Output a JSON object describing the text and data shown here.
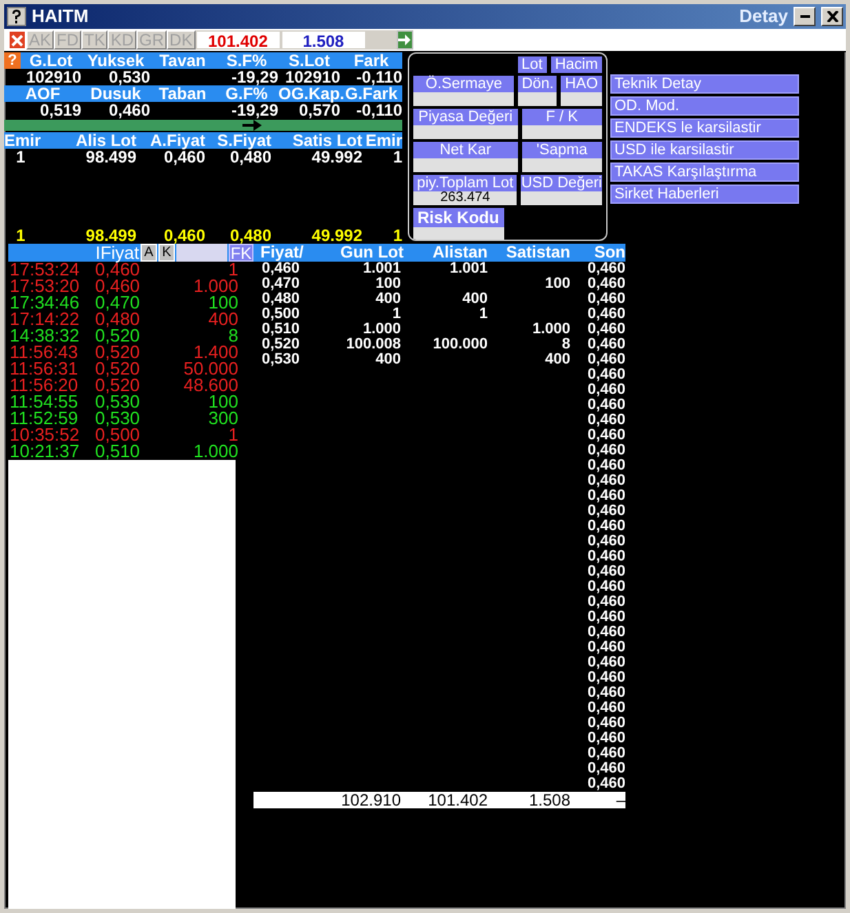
{
  "window": {
    "title": "HAITM",
    "subtitle": "Detay"
  },
  "toolbar": {
    "buttons": [
      {
        "label": "AK",
        "disabled": true
      },
      {
        "label": "FD",
        "disabled": true
      },
      {
        "label": "TK",
        "disabled": true
      },
      {
        "label": "KD",
        "disabled": true
      },
      {
        "label": "GR",
        "disabled": true
      },
      {
        "label": "DK",
        "disabled": true
      }
    ],
    "price": "101.402",
    "quantity": "1.508"
  },
  "summary": {
    "help_label": "?",
    "blocks": [
      {
        "cells": [
          {
            "header": "G.Lot",
            "value": "102910"
          },
          {
            "header": "Yuksek",
            "value": "0,530"
          },
          {
            "header": "Tavan"
          },
          {
            "header": "S.F%",
            "value": "-19,29"
          },
          {
            "header": "S.Lot",
            "value": "102910"
          },
          {
            "header": "Fark",
            "value": "-0,110"
          }
        ]
      },
      {
        "cells": [
          {
            "header": "AOF",
            "value": "0,519"
          },
          {
            "header": "Dusuk",
            "value": "0,460"
          },
          {
            "header": "Taban"
          },
          {
            "header": "G.F%",
            "value": "-19,29"
          },
          {
            "header": "OG.Kap.",
            "value": "0,570"
          },
          {
            "header": "G.Fark",
            "value": "-0,110"
          }
        ]
      }
    ]
  },
  "order_book": {
    "columns": [
      "Emir",
      "Alis Lot",
      "A.Fiyat",
      "S.Fiyat",
      "Satis Lot",
      "Emir"
    ],
    "rows": [
      [
        "1",
        "98.499",
        "0,460",
        "0,480",
        "49.992",
        "1"
      ]
    ],
    "totals": [
      "1",
      "98.499",
      "0,460",
      "0,480",
      "49.992",
      "1"
    ]
  },
  "info_panel": {
    "buttons": [
      "Lot",
      "Hacim"
    ],
    "rows": [
      [
        {
          "label": "Ö.Sermaye",
          "kind": "field"
        },
        {
          "label": "Dön.",
          "kind": "field"
        },
        {
          "label": "HAO",
          "kind": "field"
        }
      ],
      [
        {
          "label": "Piyasa Değeri",
          "kind": "field"
        },
        {
          "label": "F / K",
          "kind": "field"
        }
      ],
      [
        {
          "label": "Net Kar",
          "kind": "field"
        },
        {
          "label": "'Sapma",
          "kind": "field"
        }
      ],
      [
        {
          "label": "piy.Toplam Lot",
          "kind": "field",
          "value": "263.474"
        },
        {
          "label": "USD Değeri",
          "kind": "field"
        }
      ],
      [
        {
          "label": "Risk Kodu",
          "kind": "code"
        }
      ]
    ]
  },
  "menu": {
    "items": [
      "Teknik Detay",
      "OD. Mod.",
      "ENDEKS le karsilastir",
      "USD ile karsilastir",
      "TAKAS Karşılaştırma",
      "Sirket Haberleri"
    ]
  },
  "trades": {
    "header": "IFiyat",
    "buttons": [
      "A",
      "K"
    ],
    "filter_button": "FK",
    "rows": [
      {
        "time": "17:53:24",
        "price": "0,460",
        "lot": "1",
        "color": "#e82020"
      },
      {
        "time": "17:53:20",
        "price": "0,460",
        "lot": "1.000",
        "color": "#e82020"
      },
      {
        "time": "17:34:46",
        "price": "0,470",
        "lot": "100",
        "color": "#20e020"
      },
      {
        "time": "17:14:22",
        "price": "0,480",
        "lot": "400",
        "color": "#e82020"
      },
      {
        "time": "14:38:32",
        "price": "0,520",
        "lot": "8",
        "color": "#20e020"
      },
      {
        "time": "11:56:43",
        "price": "0,520",
        "lot": "1.400",
        "color": "#e82020"
      },
      {
        "time": "11:56:31",
        "price": "0,520",
        "lot": "50.000",
        "color": "#e82020"
      },
      {
        "time": "11:56:20",
        "price": "0,520",
        "lot": "48.600",
        "color": "#e82020"
      },
      {
        "time": "11:54:55",
        "price": "0,530",
        "lot": "100",
        "color": "#20e020"
      },
      {
        "time": "11:52:59",
        "price": "0,530",
        "lot": "300",
        "color": "#20e020"
      },
      {
        "time": "10:35:52",
        "price": "0,500",
        "lot": "1",
        "color": "#e82020"
      },
      {
        "time": "10:21:37",
        "price": "0,510",
        "lot": "1.000",
        "color": "#20e020"
      }
    ]
  },
  "price_table": {
    "columns": [
      "Fiyat/",
      "Gun Lot",
      "Alistan",
      "Satistan",
      "Son"
    ],
    "rows": [
      {
        "fiyat": "0,460",
        "gun_lot": "1.001",
        "alistan": "1.001",
        "son": "0,460"
      },
      {
        "fiyat": "0,470",
        "gun_lot": "100",
        "satistan": "100",
        "son": "0,460"
      },
      {
        "fiyat": "0,480",
        "gun_lot": "400",
        "alistan": "400",
        "son": "0,460"
      },
      {
        "fiyat": "0,500",
        "gun_lot": "1",
        "alistan": "1",
        "son": "0,460"
      },
      {
        "fiyat": "0,510",
        "gun_lot": "1.000",
        "satistan": "1.000",
        "son": "0,460"
      },
      {
        "fiyat": "0,520",
        "gun_lot": "100.008",
        "alistan": "100.000",
        "satistan": "8",
        "son": "0,460"
      },
      {
        "fiyat": "0,530",
        "gun_lot": "400",
        "satistan": "400",
        "son": "0,460"
      },
      {
        "son": "0,460"
      },
      {
        "son": "0,460"
      },
      {
        "son": "0,460"
      },
      {
        "son": "0,460"
      },
      {
        "son": "0,460"
      },
      {
        "son": "0,460"
      },
      {
        "son": "0,460"
      },
      {
        "son": "0,460"
      },
      {
        "son": "0,460"
      },
      {
        "son": "0,460"
      },
      {
        "son": "0,460"
      },
      {
        "son": "0,460"
      },
      {
        "son": "0,460"
      },
      {
        "son": "0,460"
      },
      {
        "son": "0,460"
      },
      {
        "son": "0,460"
      },
      {
        "son": "0,460"
      },
      {
        "son": "0,460"
      },
      {
        "son": "0,460"
      },
      {
        "son": "0,460"
      },
      {
        "son": "0,460"
      },
      {
        "son": "0,460"
      },
      {
        "son": "0,460"
      },
      {
        "son": "0,460"
      },
      {
        "son": "0,460"
      },
      {
        "son": "0,460"
      },
      {
        "son": "0,460"
      },
      {
        "son": "0,460"
      }
    ],
    "totals": {
      "gun_lot": "102.910",
      "alistan": "101.402",
      "satistan": "1.508",
      "son": "–"
    }
  }
}
